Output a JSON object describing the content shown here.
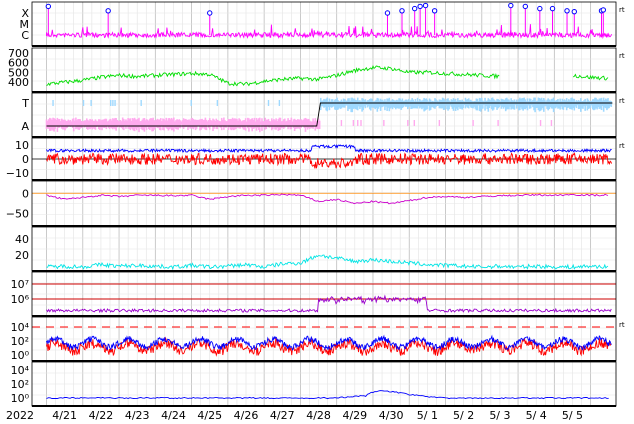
{
  "chart_data": {
    "type": "line",
    "year_label": "2022",
    "x_dates": [
      "4/21",
      "4/22",
      "4/23",
      "4/24",
      "4/25",
      "4/26",
      "4/27",
      "4/28",
      "4/29",
      "4/30",
      "5/ 1",
      "5/ 2",
      "5/ 3",
      "5/ 4",
      "5/ 5"
    ],
    "grid": true,
    "side_mark": "rt",
    "panels": [
      {
        "id": "xray-class",
        "tick_labels": [
          "X",
          "M",
          "C"
        ],
        "color": "#ff00ff",
        "flare_marker_color": "#0000ff",
        "flare_markers": [
          [
            20.05,
            0.9
          ],
          [
            21.7,
            0.8
          ],
          [
            24.5,
            0.75
          ],
          [
            29.4,
            0.75
          ],
          [
            29.8,
            0.8
          ],
          [
            30.15,
            0.85
          ],
          [
            30.3,
            0.9
          ],
          [
            30.45,
            0.92
          ],
          [
            30.7,
            0.8
          ],
          [
            32.8,
            0.92
          ],
          [
            33.2,
            0.9
          ],
          [
            33.6,
            0.85
          ],
          [
            33.95,
            0.85
          ],
          [
            34.35,
            0.8
          ],
          [
            34.55,
            0.78
          ],
          [
            35.3,
            0.8
          ],
          [
            35.35,
            0.82
          ]
        ],
        "shows_side_mark": true
      },
      {
        "id": "solar-wind-speed",
        "tick_labels": [
          "700",
          "600",
          "500",
          "400"
        ],
        "ylim": [
          300,
          750
        ],
        "color": "#00dd00",
        "series": [
          {
            "x": [
              20.0,
              20.5,
              21.0,
              21.5,
              22.0,
              22.5,
              23.0,
              23.5,
              24.0,
              24.5,
              25.0,
              25.5,
              26.0,
              26.5,
              27.0,
              27.5,
              28.0,
              28.5,
              29.0,
              29.5,
              30.0,
              30.5,
              31.0,
              31.5,
              32.0,
              32.5,
              33.0,
              33.5,
              34.0,
              34.5,
              35.0,
              35.5
            ],
            "y": [
              380,
              400,
              420,
              450,
              470,
              460,
              470,
              480,
              490,
              480,
              390,
              380,
              410,
              430,
              440,
              430,
              470,
              520,
              550,
              540,
              500,
              500,
              490,
              480,
              470,
              460,
              null,
              null,
              null,
              470,
              450,
              440
            ]
          }
        ],
        "shows_side_mark": true
      },
      {
        "id": "imf-sector",
        "tick_labels": [
          "T",
          "A"
        ],
        "colors": {
          "toward": "#9fd9ff",
          "away": "#ffaaee",
          "line": "#000000"
        },
        "sector_switch_x": 27.55,
        "shows_side_mark": true
      },
      {
        "id": "imf-bz",
        "tick_labels": [
          "10",
          "0",
          "−10"
        ],
        "ylim": [
          -15,
          15
        ],
        "colors": {
          "bt": "#0000ff",
          "bz": "#ff0000"
        },
        "shows_side_mark": true
      },
      {
        "id": "dst",
        "tick_labels": [
          "0",
          "−50"
        ],
        "ylim": [
          -80,
          30
        ],
        "color": "#cc00cc",
        "series": [
          {
            "x": [
              20.0,
              20.5,
              21.0,
              21.5,
              22.0,
              22.5,
              23.0,
              23.5,
              24.0,
              24.5,
              25.0,
              25.5,
              26.0,
              26.5,
              27.0,
              27.5,
              28.0,
              28.5,
              29.0,
              29.5,
              30.0,
              30.5,
              31.0,
              31.5,
              32.0,
              32.5,
              33.0,
              33.5,
              34.0,
              34.5,
              35.0,
              35.5
            ],
            "y": [
              -5,
              -15,
              -10,
              -5,
              -8,
              -5,
              -5,
              -6,
              -5,
              -15,
              -8,
              -5,
              -5,
              -3,
              -5,
              -20,
              -15,
              -25,
              -20,
              -25,
              -18,
              -10,
              -8,
              -10,
              -8,
              -6,
              -5,
              -4,
              -5,
              -3,
              -5,
              -4
            ]
          }
        ]
      },
      {
        "id": "kp-like",
        "tick_labels": [
          "40",
          "20"
        ],
        "ylim": [
          0,
          55
        ],
        "color": "#00e5e5",
        "series": [
          {
            "x": [
              20.0,
              20.5,
              21.0,
              21.5,
              22.0,
              22.5,
              23.0,
              23.5,
              24.0,
              24.5,
              25.0,
              25.5,
              26.0,
              26.5,
              27.0,
              27.5,
              28.0,
              28.5,
              29.0,
              29.5,
              30.0,
              30.5,
              31.0,
              31.5,
              32.0,
              32.5,
              33.0,
              33.5,
              34.0,
              34.5,
              35.0,
              35.5
            ],
            "y": [
              5,
              6,
              5,
              8,
              6,
              7,
              6,
              5,
              7,
              5,
              6,
              8,
              5,
              9,
              10,
              20,
              16,
              12,
              14,
              12,
              10,
              8,
              7,
              6,
              5,
              6,
              5,
              6,
              5,
              5,
              6,
              5
            ]
          }
        ]
      },
      {
        "id": "proton-flux",
        "tick_labels": [
          "10⁷",
          "10⁶"
        ],
        "colors": {
          "threshold": "#cc0000",
          "flux": "#9900cc"
        }
      },
      {
        "id": "electron-flux",
        "tick_labels": [
          "10⁴",
          "10²",
          "10⁰"
        ],
        "colors": {
          "threshold": "#ff0000",
          "low": "#ff0000",
          "high": "#0000ff"
        },
        "shows_side_mark": true
      },
      {
        "id": "neutron",
        "tick_labels": [
          "10⁴",
          "10²",
          "10⁰"
        ],
        "color": "#0000ff",
        "series": [
          {
            "x": [
              20.0,
              21.0,
              22.0,
              23.0,
              24.0,
              25.0,
              26.0,
              27.0,
              28.0,
              28.8,
              29.2,
              29.5,
              30.0,
              30.5,
              31.0,
              32.0,
              33.0,
              34.0,
              35.0,
              35.5
            ],
            "y": [
              1,
              1,
              1,
              1,
              1,
              1,
              1,
              1,
              1,
              2,
              12,
              8,
              3,
              1.5,
              1,
              1,
              1,
              1,
              1,
              1
            ]
          }
        ]
      }
    ]
  }
}
